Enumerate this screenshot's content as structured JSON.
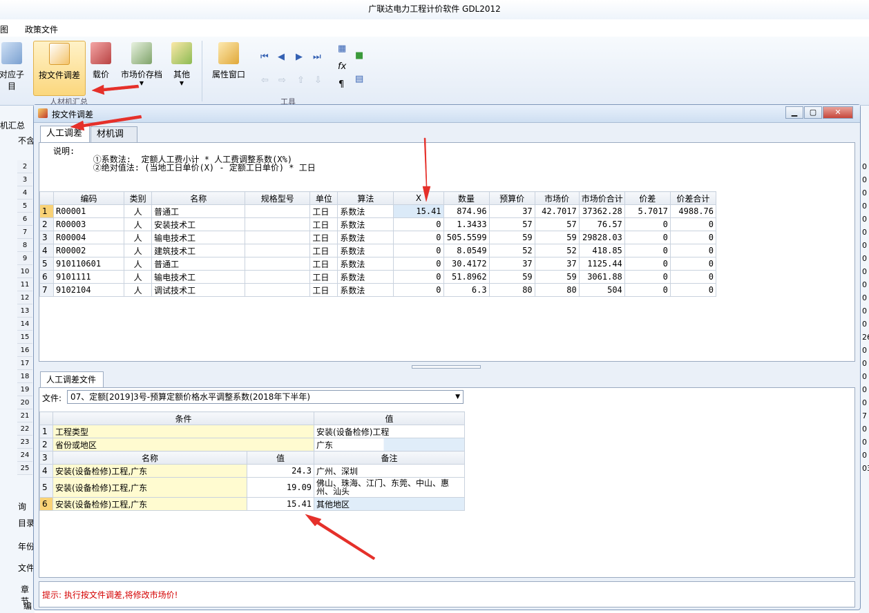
{
  "window": {
    "title": "广联达电力工程计价软件 GDL2012"
  },
  "menu": {
    "item_left": "图",
    "policy_file": "政策文件"
  },
  "ribbon": {
    "buttons": {
      "sub_item": "对应子目",
      "adjust_by_file": "按文件调差",
      "load_price": "载价",
      "market_price_archive": "市场价存档",
      "other": "其他",
      "property_window": "属性窗口"
    },
    "groups": {
      "labor_summary": "人材机汇总",
      "tools": "工具"
    }
  },
  "background": {
    "tab": "机汇总",
    "header_cell": "不含",
    "row_numbers": [
      "2",
      "3",
      "4",
      "5",
      "6",
      "7",
      "8",
      "9",
      "10",
      "11",
      "12",
      "13",
      "14",
      "15",
      "16",
      "17",
      "18",
      "19",
      "20",
      "21",
      "22",
      "23",
      "24",
      "25"
    ],
    "right_values": [
      "0",
      "0",
      "0",
      "0",
      "0",
      "0",
      "0",
      "0",
      "0",
      "0",
      "0",
      "0",
      "0",
      "26",
      "0",
      "0",
      "0",
      "0",
      "0",
      "7",
      "0",
      "0",
      "0",
      "03"
    ],
    "bottom_labels": [
      "询",
      "目录",
      "年份",
      "文件",
      "章节",
      "编"
    ]
  },
  "dialog": {
    "title": "按文件调差",
    "tabs": [
      "人工调差",
      "材机调差"
    ],
    "description": {
      "label": "说明:",
      "line1": "①系数法:  定额人工费小计 * 人工费调整系数(X%)",
      "line2": "②绝对值法: (当地工日单价(X) - 定额工日单价) * 工日"
    },
    "grid": {
      "headers": [
        "编码",
        "类别",
        "名称",
        "规格型号",
        "单位",
        "算法",
        "X",
        "数量",
        "预算价",
        "市场价",
        "市场价合计",
        "价差",
        "价差合计"
      ],
      "rows": [
        [
          "1",
          "R00001",
          "人",
          "普通工",
          "",
          "工日",
          "系数法",
          "15.41",
          "874.96",
          "37",
          "42.7017",
          "37362.28",
          "5.7017",
          "4988.76"
        ],
        [
          "2",
          "R00003",
          "人",
          "安装技术工",
          "",
          "工日",
          "系数法",
          "0",
          "1.3433",
          "57",
          "57",
          "76.57",
          "0",
          "0"
        ],
        [
          "3",
          "R00004",
          "人",
          "输电技术工",
          "",
          "工日",
          "系数法",
          "0",
          "505.5599",
          "59",
          "59",
          "29828.03",
          "0",
          "0"
        ],
        [
          "4",
          "R00002",
          "人",
          "建筑技术工",
          "",
          "工日",
          "系数法",
          "0",
          "8.0549",
          "52",
          "52",
          "418.85",
          "0",
          "0"
        ],
        [
          "5",
          "910110601",
          "人",
          "普通工",
          "",
          "工日",
          "系数法",
          "0",
          "30.4172",
          "37",
          "37",
          "1125.44",
          "0",
          "0"
        ],
        [
          "6",
          "9101111",
          "人",
          "输电技术工",
          "",
          "工日",
          "系数法",
          "0",
          "51.8962",
          "59",
          "59",
          "3061.88",
          "0",
          "0"
        ],
        [
          "7",
          "9102104",
          "人",
          "调试技术工",
          "",
          "工日",
          "系数法",
          "0",
          "6.3",
          "80",
          "80",
          "504",
          "0",
          "0"
        ]
      ]
    },
    "file_section": {
      "tab": "人工调差文件",
      "file_label": "文件:",
      "file_value": "07、定额[2019]3号-预算定额价格水平调整系数(2018年下半年)",
      "headers": {
        "condition": "条件",
        "value": "值"
      },
      "conditions": [
        {
          "no": "1",
          "name": "工程类型",
          "value": "安装(设备检修)工程"
        },
        {
          "no": "2",
          "name": "省份或地区",
          "value": "广东"
        }
      ],
      "sub_headers": {
        "no": "3",
        "name": "名称",
        "value": "值",
        "note": "备注"
      },
      "coefficients": [
        {
          "no": "4",
          "name": "安装(设备检修)工程,广东",
          "value": "24.3",
          "note": "广州、深圳"
        },
        {
          "no": "5",
          "name": "安装(设备检修)工程,广东",
          "value": "19.09",
          "note": "佛山、珠海、江门、东莞、中山、惠州、汕头"
        },
        {
          "no": "6",
          "name": "安装(设备检修)工程,广东",
          "value": "15.41",
          "note": "其他地区"
        }
      ]
    },
    "hint": "提示: 执行按文件调差,将修改市场价!"
  },
  "colors": {
    "accent": "#f9c75e",
    "hint": "#d40000",
    "arrow": "#e5302a"
  }
}
